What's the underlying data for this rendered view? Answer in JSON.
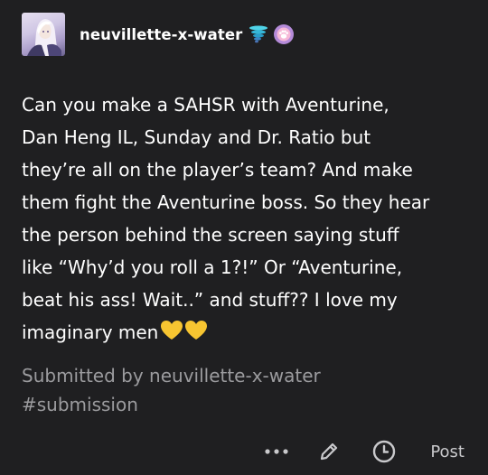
{
  "post": {
    "author": "neuvillette-x-water",
    "lines": [
      "Can you make a SAHSR with Aventurine,",
      "Dan Heng IL, Sunday and Dr. Ratio but",
      "they’re all on the player’s team? And make",
      "them fight the Aventurine boss. So they hear",
      "the person behind the screen saying stuff",
      "like “Why’d you roll a 1?!” Or “Aventurine,",
      "beat his ass! Wait..” and stuff?? I love my",
      "imaginary men"
    ],
    "submitted_by": "Submitted by neuvillette-x-water",
    "tag": "#submission"
  },
  "actions": {
    "more_label": "•••",
    "post_label": "Post"
  },
  "icons": {
    "avatar": "avatar",
    "badge_water": "water-tornado-badge-icon",
    "badge_paw": "paw-badge-icon",
    "hearts": "yellow-heart-icon",
    "more": "more-options-icon",
    "edit": "pencil-edit-icon",
    "schedule": "clock-schedule-icon"
  },
  "colors": {
    "background": "#1f1f21",
    "text": "#ffffff",
    "muted": "#9b9b9e",
    "heart": "#f7c531",
    "paw_badge": "#b58bd9"
  }
}
